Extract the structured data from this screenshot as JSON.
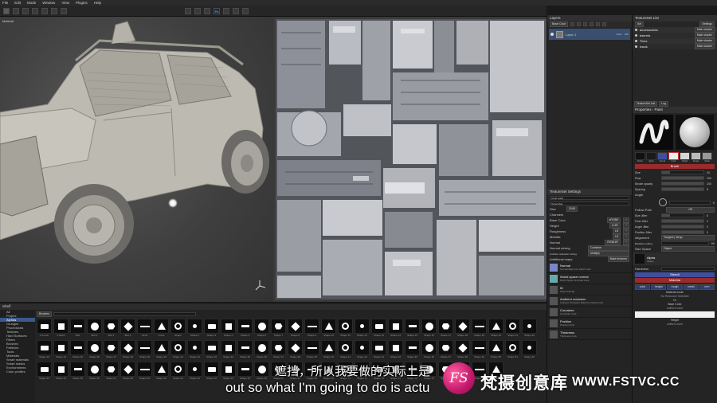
{
  "menu": [
    "File",
    "Edit",
    "Mode",
    "Window",
    "View",
    "Plugins",
    "Help"
  ],
  "viewport3d": {
    "label": "Material"
  },
  "viewport2d": {
    "label": ""
  },
  "shelf": {
    "title": "Shelf",
    "search_label": "Brushes",
    "categories": [
      "All",
      "Project",
      "Alphas",
      "Grunges",
      "Procedurals",
      "Textures",
      "Hard Surfaces",
      "Filters",
      "Brushes",
      "Particles",
      "Tools",
      "Materials",
      "Smart materials",
      "Smart masks",
      "Environments",
      "Color profiles"
    ],
    "selected_category": 2,
    "items": [
      "1 Corner",
      "4 Notch",
      "Bolt",
      "Bolt 2",
      "Bolt 3",
      "Bolt 4",
      "Circle",
      "Cross",
      "Shape",
      "Shape 2",
      "Shape 3",
      "Shape 4",
      "Shape 5",
      "Shape 6",
      "Shape 7",
      "Shape 8",
      "Shape 9",
      "Shape 10",
      "Shape 11",
      "Shape 12",
      "Shape 13",
      "Shape 14",
      "Shape 15",
      "Shape 16",
      "Shape 17",
      "Shape 18",
      "Shape 19",
      "Shape 20",
      "Shape 21",
      "Shape 22",
      "Shape 23",
      "Shape 24",
      "Shape 25",
      "Shape 26",
      "Shape 27",
      "Shape 28",
      "Shape 29",
      "Shape 30",
      "Shape 31",
      "Shape 32",
      "Shape 33",
      "Shape 34",
      "Shape 35",
      "Shape 36",
      "Shape 37",
      "Shape 38",
      "Shape 39",
      "Shape 40",
      "Shape 41",
      "Shape 42",
      "Shape 43",
      "Shape 44",
      "Shape 45",
      "Shape 46",
      "Shape 47",
      "Shape 48",
      "Shape 49",
      "Shape 50",
      "Shape 51",
      "Shape 52",
      "Shape 53",
      "Shape 54",
      "Shape 55",
      "Shape 56",
      "Shape 57",
      "Shape 58",
      "Shape 59",
      "Shape 60",
      "Shape 61",
      "Shape 62",
      "Shape 63",
      "Shape 64",
      "Shape 65",
      "Shape 66",
      "Shape 67",
      "Shape 68",
      "Shape 69",
      "Shape 70",
      "Shape 71",
      "Shape 72",
      "Shape 73",
      "Shape 74",
      "Shape 75",
      "Shape 76",
      "Shape 77",
      "Shape 78",
      "Shape 79",
      "Shape 80"
    ]
  },
  "layers": {
    "title": "Layers",
    "channel": "Base Color",
    "layer_name": "Layer 1",
    "blend": "Norm",
    "opacity": "100"
  },
  "texture_set_list": {
    "title": "TextureSet List",
    "settings_label": "Settings",
    "items": [
      {
        "name": "accessories",
        "shader": "Main shader"
      },
      {
        "name": "barrels",
        "shader": "Main shader"
      },
      {
        "name": "Tires",
        "shader": "Main shader"
      },
      {
        "name": "truck",
        "shader": "Main shader"
      }
    ],
    "tabs": [
      "TextureSet List",
      "Log"
    ]
  },
  "texture_set_settings": {
    "title": "TextureSet Settings",
    "undo_stack": "Undo stack",
    "set_name": "TextureSet",
    "size_label": "Size",
    "size_value": "2048",
    "channels_label": "Channels",
    "channels": [
      {
        "name": "Base Color",
        "fmt": "sRGB8"
      },
      {
        "name": "Height",
        "fmt": "L16F"
      },
      {
        "name": "Roughness",
        "fmt": "L8"
      },
      {
        "name": "Metallic",
        "fmt": "L8"
      },
      {
        "name": "Normal",
        "fmt": "RGB16F"
      }
    ],
    "normal_mixing_label": "Normal mixing",
    "normal_mixing_value": "Combine",
    "ao_mixing_label": "Ambient occlusion mixing",
    "ao_mixing_value": "Multiply",
    "additional_maps": "Additional maps",
    "bake_button": "Bake textures",
    "maps": [
      {
        "title": "Normal",
        "sub": "Normal Map from Mesh truck"
      },
      {
        "title": "World space normal",
        "sub": "World Space Normals truck"
      },
      {
        "title": "ID",
        "sub": "Select bitmap"
      },
      {
        "title": "Ambient occlusion",
        "sub": "Ambient Occlusion Map from Mesh truck"
      },
      {
        "title": "Curvature",
        "sub": "Curvature truck"
      },
      {
        "title": "Position",
        "sub": "Position truck"
      },
      {
        "title": "Thickness",
        "sub": "Thickness truck"
      }
    ]
  },
  "properties": {
    "title": "Properties - Paint",
    "brush_header": "Brush",
    "params": [
      {
        "name": "Size",
        "value": "20"
      },
      {
        "name": "Flow",
        "value": "100"
      },
      {
        "name": "Stroke opacity",
        "value": "100"
      },
      {
        "name": "Spacing",
        "value": "5"
      }
    ],
    "angle_label": "Angle",
    "angle_value": "0",
    "follow_path": "Follow Path",
    "follow_value": "Off",
    "jitter": [
      {
        "name": "Size Jitter",
        "value": "0"
      },
      {
        "name": "Flow Jitter",
        "value": "0"
      },
      {
        "name": "Angle Jitter",
        "value": "0"
      },
      {
        "name": "Position Jitter",
        "value": "0"
      }
    ],
    "alignment_label": "Alignment",
    "alignment_value": "Tangent | Wrap",
    "backface_label": "Backface culling",
    "backface_value": "90",
    "size_space_label": "Size Space",
    "size_space_value": "Object",
    "alpha_title": "Alpha",
    "alpha_sub": "Shape",
    "hardness_label": "Hardness",
    "stencil_header": "Stencil",
    "material_header": "Material",
    "material_channels": [
      "color",
      "height",
      "rough",
      "metal",
      "nrm"
    ],
    "material_mode": "Material mode",
    "no_resource": "No Resource Selected",
    "or": "Or",
    "base_color": "Base Color",
    "uniform": "uniform color",
    "height": "Height",
    "height_uniform": "uniform color",
    "thumb_labels": [
      "Brush",
      "Alpha",
      "Stencil",
      "Color",
      "Height",
      "Rough",
      "Metal"
    ]
  },
  "subtitle": {
    "cn": "遮挡，所以我要做的实际上是",
    "en": "out so what I'm going to do is actu"
  },
  "watermark": {
    "logo": "FS",
    "cn": "梵摄创意库",
    "url": "WWW.FSTVC.CC"
  },
  "colors": {
    "accent_blue": "#3a5a8a",
    "brush_red": "#9a2b2b",
    "stencil_blue": "#3f4fa0",
    "material_purple": "#5b3f90",
    "watermark_pink": "#c2186b"
  }
}
